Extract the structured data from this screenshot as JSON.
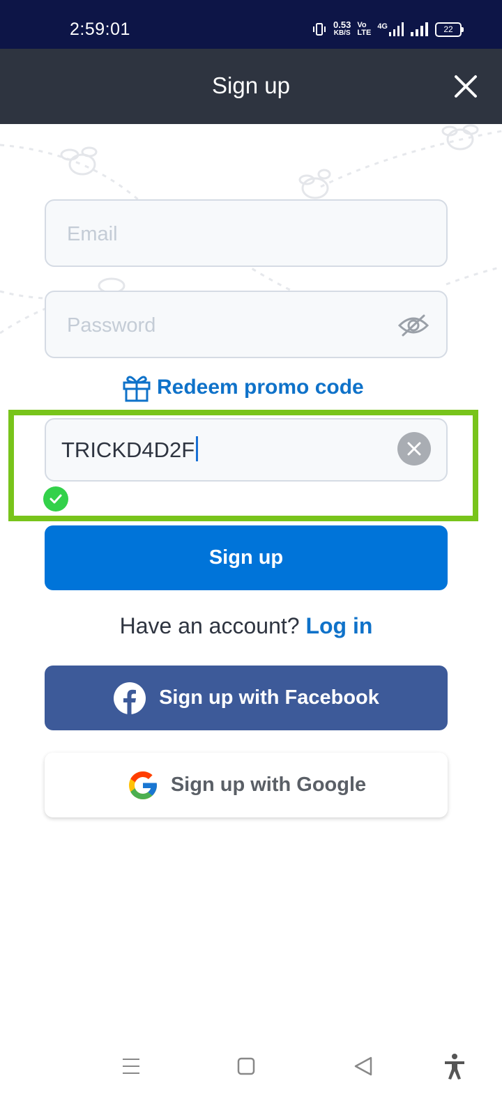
{
  "status_bar": {
    "time": "2:59:01",
    "net_speed_value": "0.53",
    "net_speed_unit": "KB/S",
    "volte_top": "Vo",
    "volte_bottom": "LTE",
    "network_type": "4G",
    "battery": "22"
  },
  "header": {
    "title": "Sign up",
    "close_icon": "close-icon"
  },
  "form": {
    "email_placeholder": "Email",
    "password_placeholder": "Password",
    "promo_link_label": "Redeem promo code",
    "promo_code_value": "TRICKD4D2F",
    "signup_label": "Sign up",
    "have_account_text": "Have an account?",
    "login_label": "Log in",
    "facebook_label": "Sign up with Facebook",
    "google_label": "Sign up with Google"
  },
  "colors": {
    "status_bar": "#0d1547",
    "header": "#2e3440",
    "primary": "#0074d9",
    "link": "#0f72c9",
    "facebook": "#3d5a99",
    "highlight": "#78c41b",
    "success": "#33d14a"
  },
  "nav": {
    "icons": [
      "menu-icon",
      "home-icon",
      "back-icon",
      "accessibility-icon"
    ]
  }
}
